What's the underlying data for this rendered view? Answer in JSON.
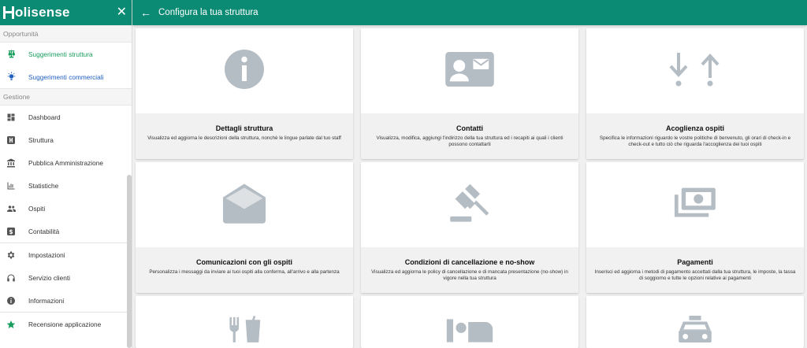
{
  "app": {
    "logo": "olisense",
    "close": "✕"
  },
  "sidebar": {
    "sections": [
      {
        "title": "Opportunità"
      },
      {
        "title": "Gestione"
      }
    ],
    "opportunita": [
      {
        "label": "Suggerimenti struttura",
        "icon": "scale-icon",
        "color": "#169c5c"
      },
      {
        "label": "Suggerimenti commerciali",
        "icon": "lightbulb-icon",
        "color": "#1f5fbf"
      }
    ],
    "gestione": [
      {
        "label": "Dashboard",
        "icon": "dashboard-icon"
      },
      {
        "label": "Struttura",
        "icon": "hotel-icon"
      },
      {
        "label": "Pubblica Amministrazione",
        "icon": "institution-icon"
      },
      {
        "label": "Statistiche",
        "icon": "bar-chart-icon"
      },
      {
        "label": "Ospiti",
        "icon": "people-icon"
      },
      {
        "label": "Contabilità",
        "icon": "dollar-icon"
      }
    ],
    "other": [
      {
        "label": "Impostazioni",
        "icon": "gear-icon"
      },
      {
        "label": "Servizio clienti",
        "icon": "headset-icon"
      },
      {
        "label": "Informazioni",
        "icon": "info-icon"
      }
    ],
    "bottom": [
      {
        "label": "Recensione applicazione",
        "icon": "star-icon",
        "color": "#169c5c"
      }
    ]
  },
  "header": {
    "back": "←",
    "title": "Configura la tua struttura"
  },
  "cards": [
    {
      "title": "Dettagli struttura",
      "desc": "Visualizza ed aggiorna le descrizioni della struttura, nonchè le lingue parlate dal tuo staff",
      "icon": "info-icon"
    },
    {
      "title": "Contatti",
      "desc": "Visualizza, modifica, aggiungi l'indirizzo della tua struttura ed i recapiti ai quali i clienti possono contattarti",
      "icon": "contact-card-icon"
    },
    {
      "title": "Acoglienza ospiti",
      "desc": "Specifica le informazioni riguardo le vostre politiche di benvenuto, gli orari di check-in e check-out e tutto ciò che riguarda l'accoglienza dei tuoi ospiti",
      "icon": "arrows-in-out-icon"
    },
    {
      "title": "Comunicazioni con gli ospiti",
      "desc": "Personalizza i messaggi da inviare ai tuoi ospiti alla conferma, all'arrivo e alla partenza",
      "icon": "open-mail-icon"
    },
    {
      "title": "Condizioni di cancellazione e no-show",
      "desc": "Visualizza ed aggiorna le policy di cancellazione e di mancata presentazione (no-show) in vigore nella tua struttura",
      "icon": "gavel-icon"
    },
    {
      "title": "Pagamenti",
      "desc": "Inserisci ed aggiorna i metodi di pagamento accettati dalla tua struttura, le imposte, la tassa di soggiorno e tutte le opzioni relative ai pagamenti",
      "icon": "money-icon"
    },
    {
      "title": "",
      "desc": "",
      "icon": "restaurant-icon"
    },
    {
      "title": "",
      "desc": "",
      "icon": "bed-icon"
    },
    {
      "title": "",
      "desc": "",
      "icon": "taxi-icon"
    }
  ],
  "colors": {
    "brand": "#0b8a74",
    "icon_gray": "#b4bcc4",
    "accent_green": "#169c5c",
    "accent_blue": "#1f5fbf"
  }
}
